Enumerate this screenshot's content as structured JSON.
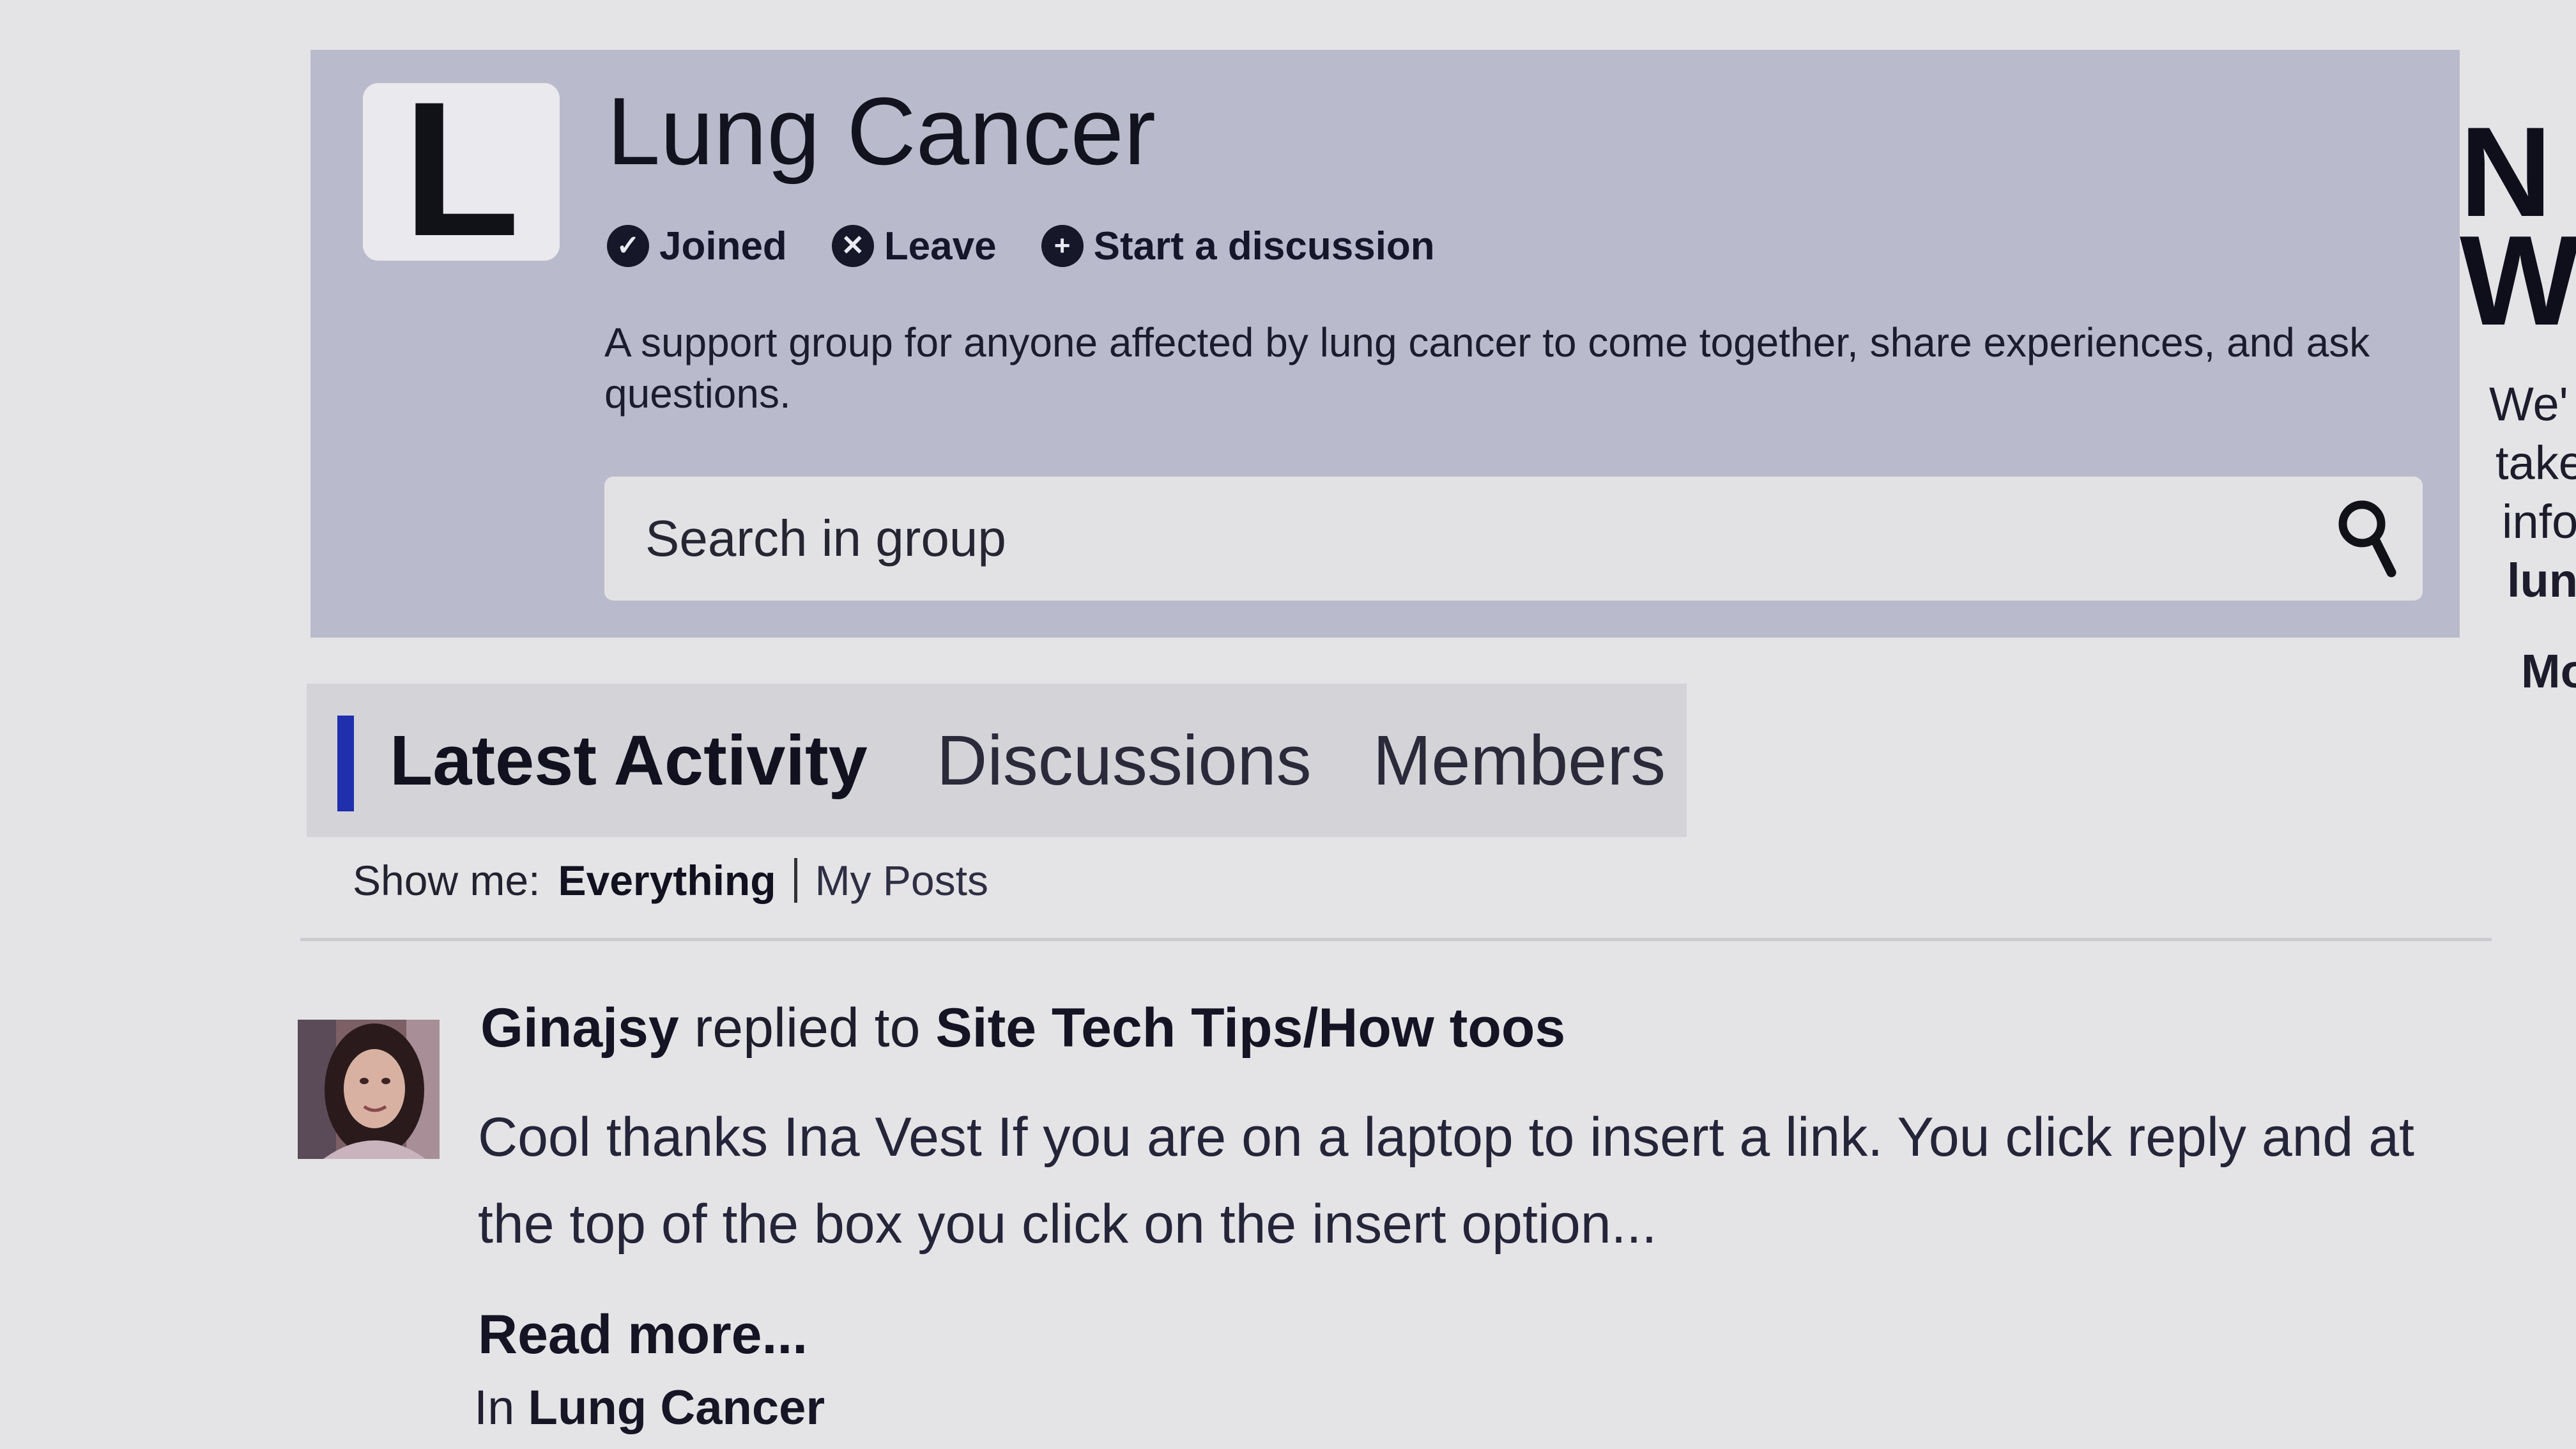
{
  "group": {
    "logo_letter": "L",
    "title": "Lung Cancer",
    "actions": {
      "joined": "Joined",
      "leave": "Leave",
      "start": "Start a discussion"
    },
    "description": "A support group for anyone affected by lung cancer to come together, share experiences, and ask questions.",
    "search_placeholder": "Search in group"
  },
  "sidebar": {
    "big_line1": "N",
    "big_line2": "W",
    "lines": [
      "We'",
      "take",
      "info",
      "lun"
    ],
    "line_bold": "Mo"
  },
  "tabs": [
    "Latest Activity",
    "Discussions",
    "Members"
  ],
  "filter": {
    "label": "Show me:",
    "options": [
      "Everything",
      "My Posts"
    ]
  },
  "activity": {
    "user": "Ginajsy",
    "verb": "replied to",
    "topic": "Site Tech Tips/How toos",
    "excerpt": "Cool thanks Ina Vest If you are on a laptop to insert a link. You click reply and at the top of the box you click on the insert option...",
    "read_more": "Read more...",
    "in_label": "In",
    "group_name": "Lung Cancer"
  },
  "colors": {
    "header_bg": "#b9bbcc",
    "tab_accent": "#1f2fae",
    "page_bg": "#e4e4e6"
  }
}
